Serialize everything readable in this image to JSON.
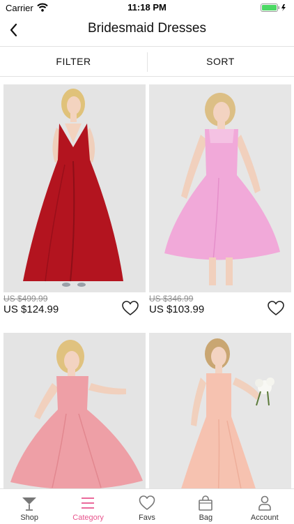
{
  "status_bar": {
    "carrier": "Carrier",
    "time": "11:18 PM"
  },
  "nav": {
    "title": "Bridesmaid Dresses"
  },
  "toolbar": {
    "filter_label": "FILTER",
    "sort_label": "SORT"
  },
  "products": [
    {
      "old_price": "US $499.99",
      "price": "US $124.99",
      "dress_color": "#b3141f"
    },
    {
      "old_price": "US $346.99",
      "price": "US $103.99",
      "dress_color": "#f1a9d9"
    },
    {
      "dress_color": "#ee9fa6"
    },
    {
      "dress_color": "#f6c2b0"
    }
  ],
  "tabs": [
    {
      "label": "Shop",
      "icon": "cocktail-glass-icon"
    },
    {
      "label": "Category",
      "icon": "menu-lines-icon",
      "active": true
    },
    {
      "label": "Favs",
      "icon": "heart-icon"
    },
    {
      "label": "Bag",
      "icon": "shopping-bag-icon"
    },
    {
      "label": "Account",
      "icon": "person-icon"
    }
  ],
  "colors": {
    "accent": "#e8548d",
    "divider": "#e2e2e2",
    "image_background": "#e4e4e4"
  }
}
